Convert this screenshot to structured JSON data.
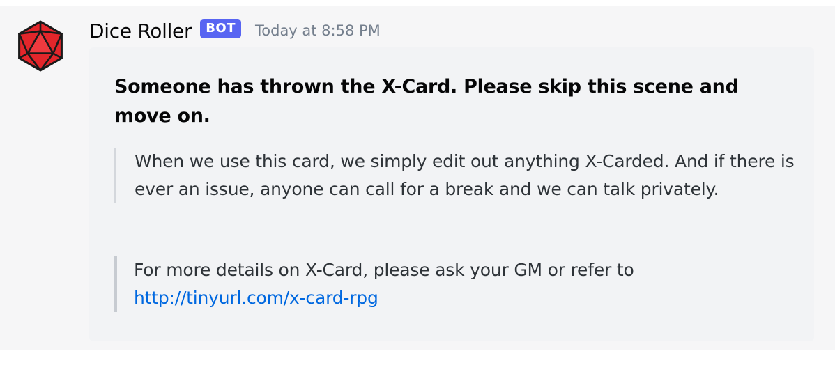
{
  "message": {
    "username": "Dice Roller",
    "bot_tag": "BOT",
    "timestamp": "Today at 8:58 PM",
    "avatar_icon": "d20-dice-icon",
    "avatar_color": "#e3262b"
  },
  "embed": {
    "title": "Someone has thrown the X-Card. Please skip this scene and move on.",
    "quote_text": "When we use this card, we simply edit out anything X-Carded. And if there is ever an issue, anyone can call for a break and we can talk privately.",
    "details_text": "For more details on X-Card, please ask your GM or refer to",
    "details_link": "http://tinyurl.com/x-card-rpg"
  },
  "colors": {
    "bot_tag": "#5865f2",
    "link": "#0068e0",
    "embed_background": "#f2f3f5"
  }
}
